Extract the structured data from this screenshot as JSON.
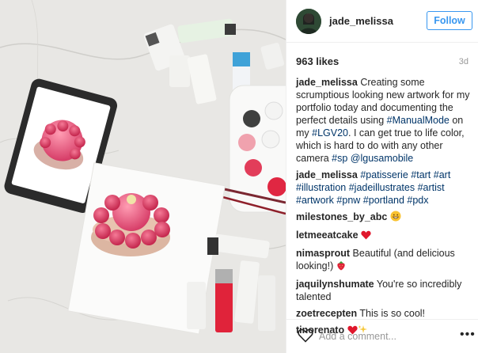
{
  "header": {
    "username": "jade_melissa",
    "follow_label": "Follow",
    "avatar_icon": "profile-avatar"
  },
  "stats": {
    "likes": "963 likes",
    "ago": "3d"
  },
  "caption": {
    "user": "jade_melissa",
    "text_1": " Creating some scrumptious looking new artwork for my portfolio today and documenting the perfect details using ",
    "tag_1": "#ManualMode",
    "text_2": " on my ",
    "tag_2": "#LGV20",
    "text_3": ". I can get true to life color, which is hard to do with any other camera ",
    "tag_3": "#sp",
    "text_4": " ",
    "tag_4": "@lgusamobile"
  },
  "hashtags": {
    "user": "jade_melissa",
    "tags": [
      "#patisserie",
      "#tart",
      "#art",
      "#illustration",
      "#jadeillustrates",
      "#artist",
      "#artwork",
      "#pnw",
      "#portland",
      "#pdx"
    ]
  },
  "comments": [
    {
      "user": "milestones_by_abc",
      "text": " ",
      "emoji": "grin"
    },
    {
      "user": "letmeeatcake",
      "text": " ",
      "emoji": "heart"
    },
    {
      "user": "nimasprout",
      "text": " Beautiful (and delicious looking!) ",
      "emoji": "strawberry"
    },
    {
      "user": "jaquilynshumate",
      "text": " You're so incredibly talented",
      "emoji": ""
    },
    {
      "user": "zoetrecepten",
      "text": " This is so cool!",
      "emoji": ""
    },
    {
      "user": "tinorenato",
      "text": " ",
      "emoji": "heart-sparkles"
    }
  ],
  "footer": {
    "add_comment_placeholder": "Add a comment...",
    "more_label": "•••"
  },
  "colors": {
    "accent": "#3897f0",
    "hashtag": "#003569",
    "text": "#262626",
    "muted": "#999999"
  }
}
